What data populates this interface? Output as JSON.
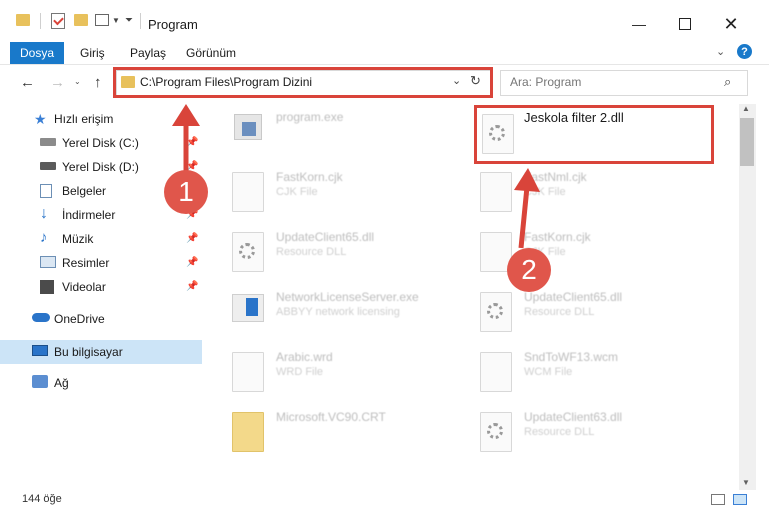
{
  "window": {
    "title": "Program"
  },
  "ribbon": {
    "tabs": [
      "Dosya",
      "Giriş",
      "Paylaş",
      "Görünüm"
    ]
  },
  "address": {
    "path": "C:\\Program Files\\Program Dizini"
  },
  "search": {
    "placeholder": "Ara: Program"
  },
  "sidebar": {
    "quick_access": "Hızlı erişim",
    "items": [
      "Yerel Disk (C:)",
      "Yerel Disk (D:)",
      "Belgeler",
      "İndirmeler",
      "Müzik",
      "Resimler",
      "Videolar"
    ],
    "onedrive": "OneDrive",
    "this_pc": "Bu bilgisayar",
    "network": "Ağ"
  },
  "files": [
    {
      "name": "program.exe",
      "desc": ""
    },
    {
      "name": "Jeskola filter 2.dll",
      "desc": ""
    },
    {
      "name": "FastKorn.cjk",
      "desc": "CJK File"
    },
    {
      "name": "FastNml.cjk",
      "desc": "CJK File"
    },
    {
      "name": "UpdateClient65.dll",
      "desc": "Resource DLL"
    },
    {
      "name": "FastKorn.cjk",
      "desc": "CJK File"
    },
    {
      "name": "NetworkLicenseServer.exe",
      "desc": "ABBYY network licensing"
    },
    {
      "name": "UpdateClient65.dll",
      "desc": "Resource DLL"
    },
    {
      "name": "Arabic.wrd",
      "desc": "WRD File"
    },
    {
      "name": "SndToWF13.wcm",
      "desc": "WCM File"
    },
    {
      "name": "Microsoft.VC90.CRT",
      "desc": ""
    },
    {
      "name": "UpdateClient63.dll",
      "desc": "Resource DLL"
    }
  ],
  "status": {
    "count": "144 öğe"
  },
  "annotations": {
    "badge1": "1",
    "badge2": "2"
  },
  "colors": {
    "accent": "#1979ca",
    "annotation": "#d9443a",
    "badge": "#e0564b"
  }
}
